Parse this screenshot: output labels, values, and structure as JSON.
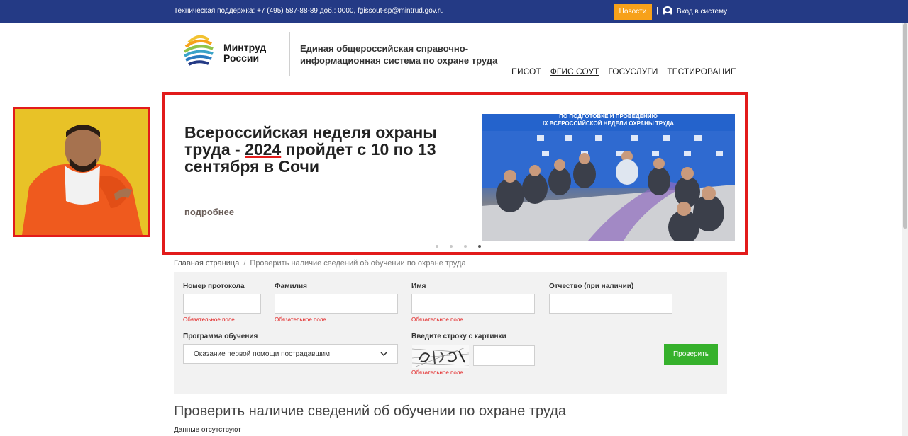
{
  "topbar": {
    "support": "Техническая поддержка: +7 (495) 587-88-89 доб.: 0000, fgissout-sp@mintrud.gov.ru",
    "news_label": "Новости",
    "separator": "|",
    "login_label": "Вход в систему"
  },
  "header": {
    "brand_line1": "Минтруд",
    "brand_line2": "России",
    "system_title": "Единая общероссийская справочно-информационная система по охране труда",
    "nav": [
      "ЕИСОТ",
      "ФГИС СОУТ",
      "ГОСУСЛУГИ",
      "ТЕСТИРОВАНИЕ"
    ]
  },
  "banner": {
    "title_before": "Всероссийская неделя охраны труда - ",
    "title_year": "2024",
    "title_after": " пройдет с 10 по 13 сентября в Сочи",
    "more": "подробнее",
    "image_caption_1": "ПО ПОДГОТОВКЕ И ПРОВЕДЕНИЮ",
    "image_caption_2": "IX ВСЕРОССИЙСКОЙ НЕДЕЛИ ОХРАНЫ ТРУДА",
    "slides": 4,
    "active_slide": 4
  },
  "breadcrumb": {
    "home": "Главная страница",
    "sep": "/",
    "current": "Проверить наличие сведений об обучении по охране труда"
  },
  "form": {
    "protocol_label": "Номер протокола",
    "surname_label": "Фамилия",
    "name_label": "Имя",
    "patronymic_label": "Отчество (при наличии)",
    "required_text": "Обязательное поле",
    "program_label": "Программа обучения",
    "program_value": "Оказание первой помощи пострадавшим",
    "captcha_label": "Введите строку с картинки",
    "check_label": "Проверить"
  },
  "results": {
    "title": "Проверить наличие сведений об обучении по охране труда",
    "empty": "Данные отсутствуют"
  },
  "colors": {
    "topbar": "#243a85",
    "news": "#f7a11a",
    "check": "#36b12c",
    "highlight": "#e21b1b"
  }
}
